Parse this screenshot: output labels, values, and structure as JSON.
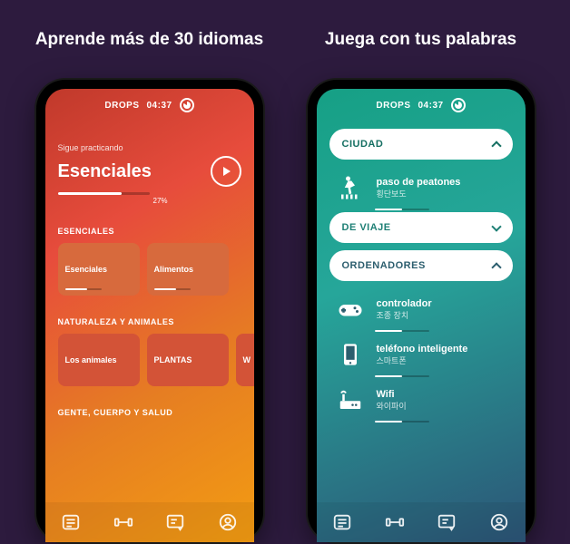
{
  "headlines": {
    "left": "Aprende más de 30 idiomas",
    "right": "Juega con tus palabras"
  },
  "topbar": {
    "app": "DROPS",
    "time": "04:37"
  },
  "left": {
    "subtitle": "Sigue practicando",
    "title": "Esenciales",
    "progress_pct": "27%",
    "sections": [
      {
        "label": "ESENCIALES",
        "cards": [
          "Esenciales",
          "Alimentos"
        ]
      },
      {
        "label": "NATURALEZA Y ANIMALES",
        "cards": [
          "Los animales",
          "PLANTAS",
          "W"
        ]
      },
      {
        "label": "GENTE, CUERPO Y SALUD",
        "cards": []
      }
    ]
  },
  "right": {
    "pills": {
      "ciudad": "CIUDAD",
      "viaje": "DE VIAJE",
      "orden": "ORDENADORES"
    },
    "words_city": [
      {
        "main": "paso de peatones",
        "sub": "횡단보도"
      }
    ],
    "words_ord": [
      {
        "main": "controlador",
        "sub": "조종 장치"
      },
      {
        "main": "teléfono inteligente",
        "sub": "스마트폰"
      },
      {
        "main": "Wifi",
        "sub": "와이파이"
      }
    ]
  },
  "nav": [
    "list-icon",
    "dumbbell-icon",
    "review-icon",
    "profile-icon"
  ]
}
